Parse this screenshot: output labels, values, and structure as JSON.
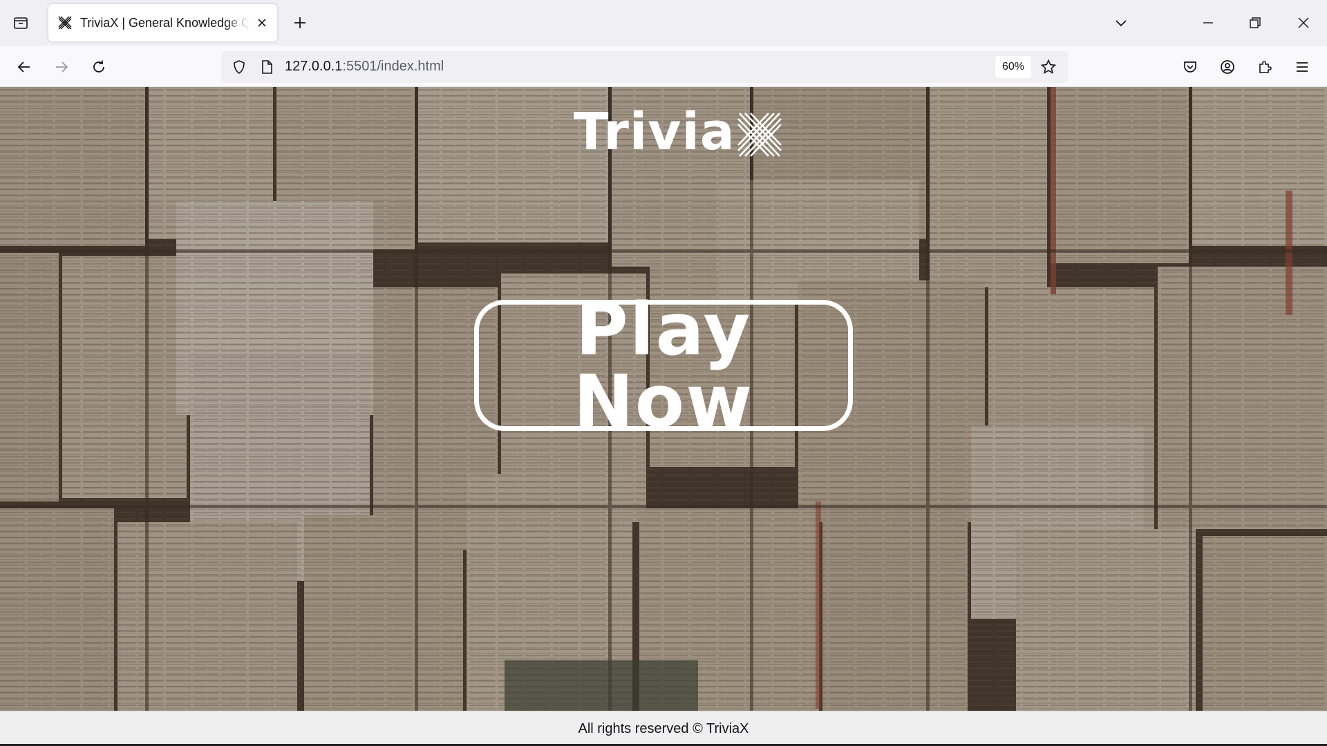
{
  "browser": {
    "tab": {
      "title": "TriviaX | General Knowledge Quiz",
      "favicon": "triviax-x-icon"
    },
    "urlbar": {
      "host": "127.0.0.1",
      "path": ":5501/index.html",
      "zoom": "60%"
    },
    "icons": {
      "tab_list": "tab-list-icon",
      "new_tab": "plus-icon",
      "list_all_tabs": "chevron-down-icon",
      "minimize": "minimize-icon",
      "restore": "restore-icon",
      "close": "close-icon",
      "back": "back-arrow-icon",
      "forward": "forward-arrow-icon",
      "reload": "reload-icon",
      "shield": "shield-icon",
      "page": "page-icon",
      "bookmark": "star-icon",
      "pocket": "pocket-icon",
      "account": "account-icon",
      "extensions": "extensions-icon",
      "menu": "hamburger-menu-icon"
    }
  },
  "page": {
    "logo_text": "Trivia",
    "play_button_label": "Play Now",
    "footer_text": "All rights reserved © TriviaX",
    "colors": {
      "accent": "#ffffff",
      "background_tint": "#3a322b",
      "footer_bg": "#efefef"
    }
  }
}
